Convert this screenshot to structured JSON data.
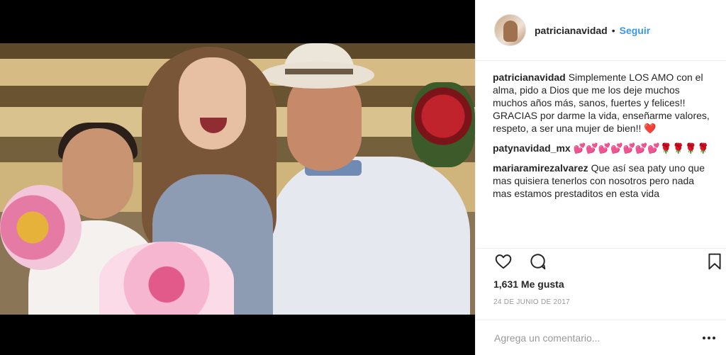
{
  "post": {
    "username": "patricianavidad",
    "follow_label": "Seguir",
    "dot": "•",
    "avatar_icon": "profile-avatar",
    "photo_icon": "post-photo"
  },
  "comments": [
    {
      "user": "patricianavidad",
      "text": "Simplemente LOS AMO con el alma, pido a Dios que me los deje muchos muchos años más, sanos, fuertes y felices!! GRACIAS por darme la vida, enseñarme valores, respeto, a ser una mujer de bien!!",
      "emoji": "❤️"
    },
    {
      "user": "patynavidad_mx",
      "text": "💕💕💕💕💕💕💕🌹🌹🌹🌹",
      "emoji": ""
    },
    {
      "user": "mariaramirezalvarez",
      "text": "Que así sea paty uno que mas quisiera tenerlos con nosotros pero nada mas estamos prestaditos en esta vida",
      "emoji": ""
    }
  ],
  "actions": {
    "like_icon": "heart-icon",
    "comment_icon": "comment-icon",
    "save_icon": "bookmark-icon"
  },
  "likes": "1,631 Me gusta",
  "date": "24 DE JUNIO DE 2017",
  "add_comment": {
    "placeholder": "Agrega un comentario...",
    "more_icon": "more-options-icon"
  },
  "colors": {
    "link_blue": "#3897f0",
    "text": "#262626",
    "muted": "#999999",
    "heart_red": "#ed4956"
  }
}
